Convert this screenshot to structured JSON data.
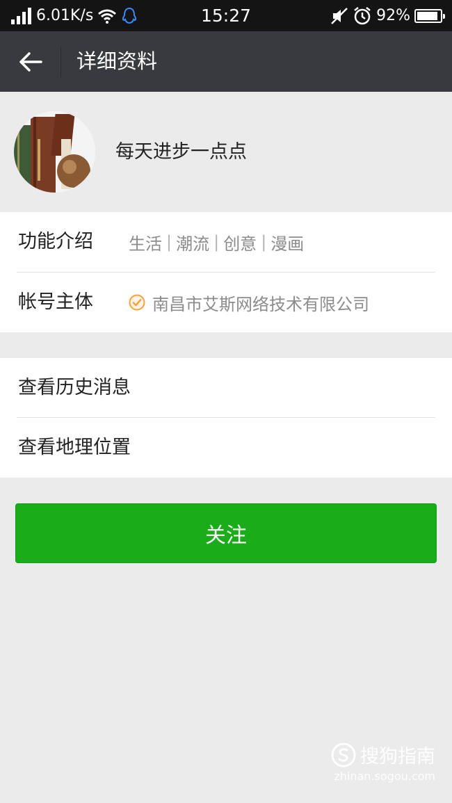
{
  "status_bar": {
    "net_speed": "6.01K/s",
    "time": "15:27",
    "battery_pct": "92%",
    "battery_level": 0.92,
    "icons": [
      "signal-icon",
      "wifi-icon",
      "qq-icon",
      "mute-icon",
      "alarm-icon",
      "battery-icon"
    ]
  },
  "header": {
    "title": "详细资料",
    "back_icon": "back-arrow-icon"
  },
  "profile": {
    "name": "每天进步一点点"
  },
  "info": {
    "intro_label": "功能介绍",
    "tags": [
      "生活",
      "潮流",
      "创意",
      "漫画"
    ],
    "tag_separator": "|",
    "owner_label": "帐号主体",
    "owner_value": "南昌市艾斯网络技术有限公司",
    "verified_icon": "verified-check-icon"
  },
  "actions": {
    "history": "查看历史消息",
    "location": "查看地理位置"
  },
  "follow_button": "关注",
  "watermark": {
    "brand": "搜狗指南",
    "url": "zhinan.sogou.com"
  },
  "colors": {
    "accent_green": "#1aad19",
    "titlebar": "#393a3f",
    "verified_orange": "#f5a33a"
  }
}
